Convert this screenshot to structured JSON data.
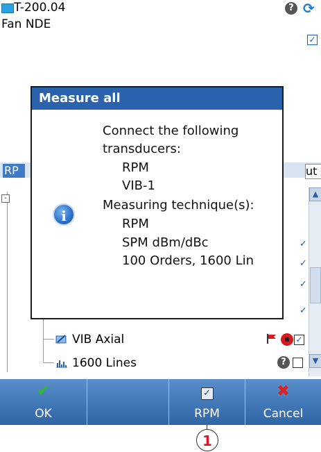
{
  "header": {
    "title": "T-200.04",
    "subtitle": "Fan NDE",
    "icons": [
      "folder-icon",
      "help-icon",
      "refresh-icon",
      "checkbox-icon"
    ]
  },
  "tabs": {
    "left": "RP",
    "right": "ut"
  },
  "tree": {
    "rows": [
      {
        "label": "VIB Axial",
        "icon": "vib-measure-icon",
        "status": [
          "flag-icon",
          "stop-icon",
          "checked-box"
        ]
      },
      {
        "label": "1600 Lines",
        "icon": "spectrum-icon",
        "status": [
          "help-icon",
          "empty-box"
        ]
      }
    ]
  },
  "dialog": {
    "title": "Measure all",
    "icon": "info-icon",
    "lines": [
      "Connect the following",
      "transducers:",
      "RPM",
      "VIB-1",
      "Measuring technique(s):",
      "RPM",
      "SPM dBm/dBc",
      "100 Orders, 1600 Lin"
    ]
  },
  "toolbar": {
    "ok_label": "OK",
    "blank_label": "",
    "rpm_label": "RPM",
    "cancel_label": "Cancel"
  },
  "callout": "1",
  "colors": {
    "title_bar": "#2a62ad",
    "toolbar": "#3f74b3",
    "ok_check": "#2dbb2d",
    "cancel_x": "#e02020",
    "callout_text": "#d9191f"
  }
}
